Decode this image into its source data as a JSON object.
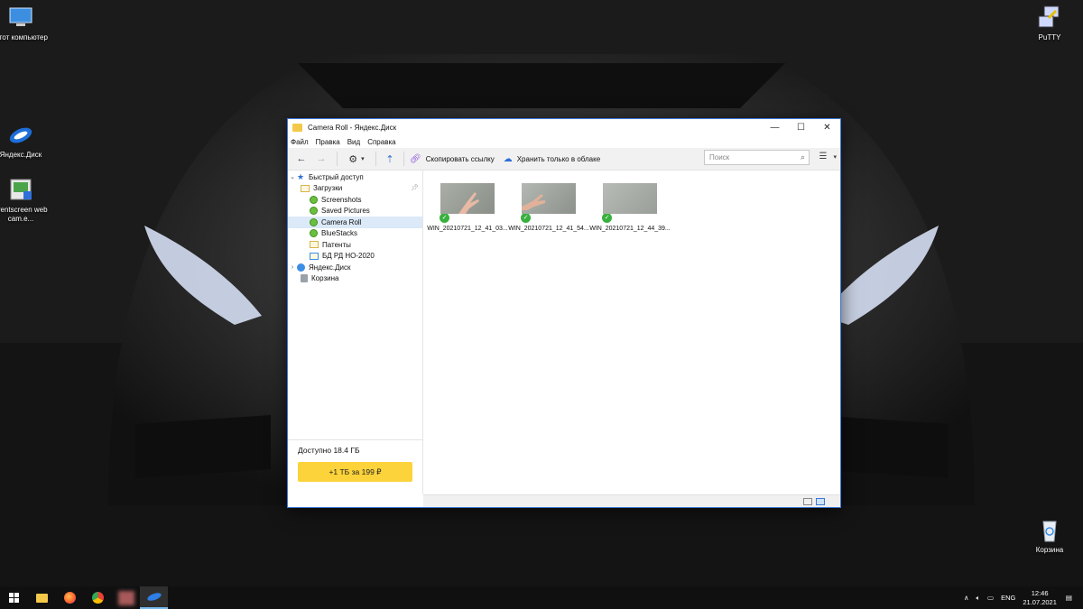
{
  "desktop": {
    "icons": [
      {
        "label": "Этот компьютер",
        "icon": "computer-icon"
      },
      {
        "label": "Яндекс.Диск",
        "icon": "yandex-disk-icon"
      },
      {
        "label": "prentscreen web cam.e...",
        "icon": "screenshot-app-icon"
      },
      {
        "label": "PuTTY",
        "icon": "putty-icon"
      },
      {
        "label": "Корзина",
        "icon": "recycle-bin-icon"
      }
    ]
  },
  "window": {
    "title": "Camera Roll - Яндекс.Диск",
    "menu": [
      "Файл",
      "Правка",
      "Вид",
      "Справка"
    ],
    "toolbar": {
      "copy_link": "Скопировать ссылку",
      "cloud_only": "Хранить только в облаке",
      "search_placeholder": "Поиск"
    },
    "tree": [
      {
        "label": "Быстрый доступ",
        "type": "star",
        "expanded": true
      },
      {
        "label": "Загрузки",
        "type": "folder"
      },
      {
        "label": "Screenshots",
        "type": "synced"
      },
      {
        "label": "Saved Pictures",
        "type": "synced"
      },
      {
        "label": "Camera Roll",
        "type": "synced",
        "selected": true
      },
      {
        "label": "BlueStacks",
        "type": "synced"
      },
      {
        "label": "Патенты",
        "type": "folder"
      },
      {
        "label": "БД РД НО-2020",
        "type": "disk-folder"
      },
      {
        "label": "Яндекс.Диск",
        "type": "disk"
      },
      {
        "label": "Корзина",
        "type": "trash"
      }
    ],
    "storage": {
      "free": "Доступно 18.4 ГБ",
      "upgrade": "+1 ТБ за 199 ₽"
    },
    "files": [
      {
        "name": "WIN_20210721_12_41_03..."
      },
      {
        "name": "WIN_20210721_12_41_54..."
      },
      {
        "name": "WIN_20210721_12_44_39..."
      }
    ]
  },
  "taskbar": {
    "lang": "ENG",
    "time": "12:46",
    "date": "21.07.2021"
  },
  "colors": {
    "accent": "#3b78d8",
    "upgrade": "#fcd33a",
    "synced": "#38b03e",
    "selection": "#dbe9f8"
  }
}
